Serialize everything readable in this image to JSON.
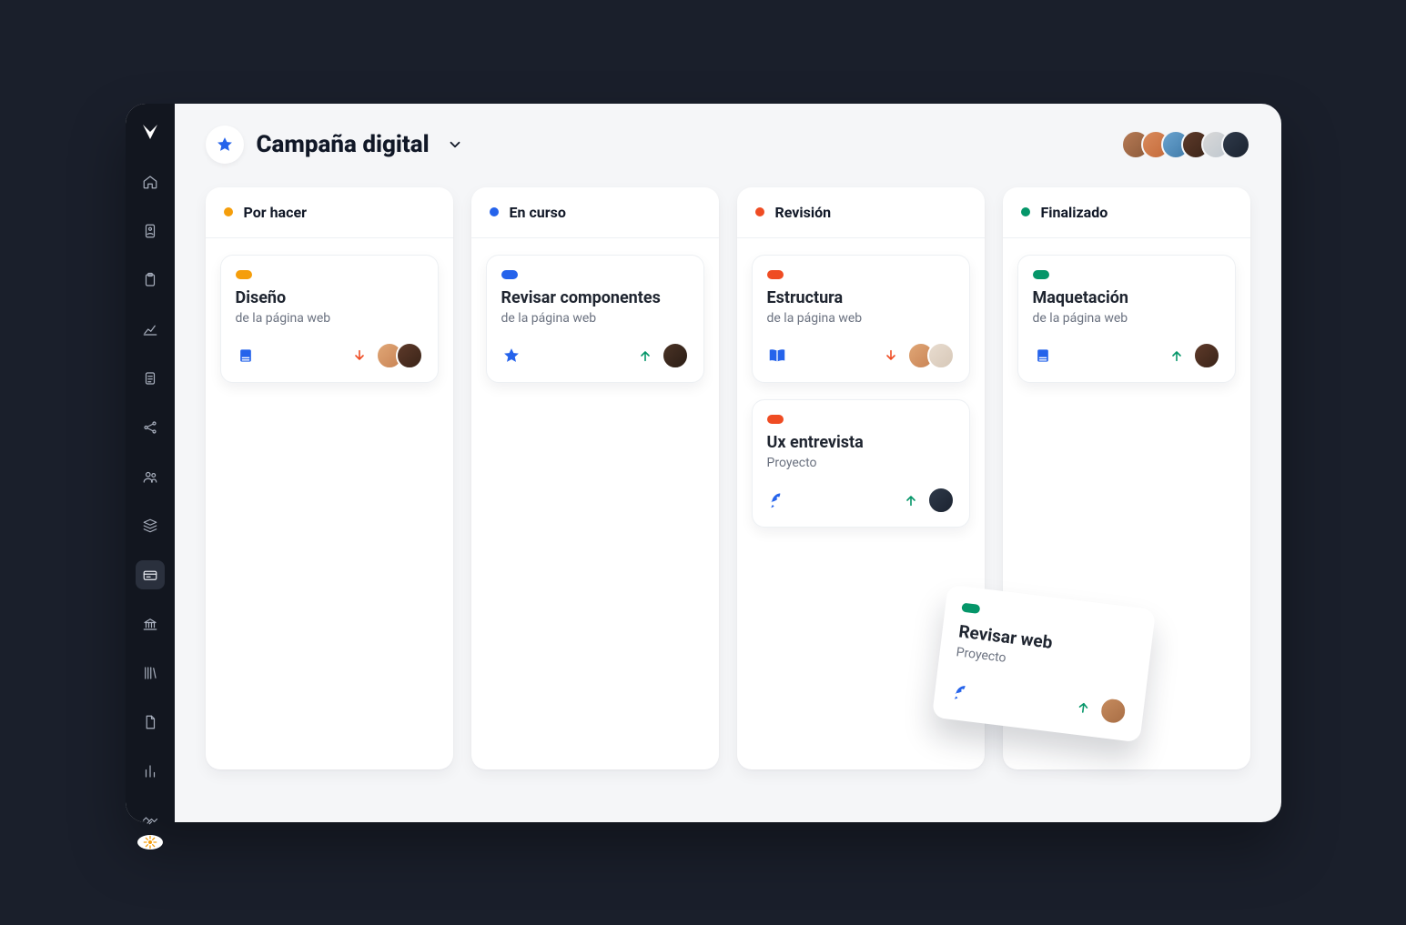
{
  "page": {
    "title": "Campaña digital"
  },
  "colors": {
    "orange": "#f59e0b",
    "blue": "#2563eb",
    "red": "#ef4c23",
    "green": "#059669"
  },
  "sidebar": {
    "items": [
      {
        "icon": "home"
      },
      {
        "icon": "id-badge"
      },
      {
        "icon": "clipboard"
      },
      {
        "icon": "chart"
      },
      {
        "icon": "note"
      },
      {
        "icon": "share"
      },
      {
        "icon": "team"
      },
      {
        "icon": "stack"
      },
      {
        "icon": "card",
        "active": true
      },
      {
        "icon": "bank"
      },
      {
        "icon": "books"
      },
      {
        "icon": "file"
      },
      {
        "icon": "bars"
      },
      {
        "icon": "handshake"
      }
    ]
  },
  "header_members": [
    {
      "avatar": "av1"
    },
    {
      "avatar": "av2"
    },
    {
      "avatar": "av3"
    },
    {
      "avatar": "av4"
    },
    {
      "avatar": "av5"
    },
    {
      "avatar": "av6"
    }
  ],
  "board": {
    "columns": [
      {
        "key": "todo",
        "title": "Por hacer",
        "dot_color": "orange",
        "cards": [
          {
            "tag_color": "orange",
            "title": "Diseño",
            "subtitle": "de la página web",
            "category_icon": "book",
            "priority": "low",
            "assignees": [
              "av7",
              "av4"
            ]
          }
        ]
      },
      {
        "key": "inprogress",
        "title": "En curso",
        "dot_color": "blue",
        "cards": [
          {
            "tag_color": "blue",
            "title": "Revisar componentes",
            "subtitle": "de la página web",
            "category_icon": "star",
            "priority": "high",
            "assignees": [
              "av8"
            ]
          }
        ]
      },
      {
        "key": "review",
        "title": "Revisión",
        "dot_color": "red",
        "cards": [
          {
            "tag_color": "red",
            "title": "Estructura",
            "subtitle": "de la página web",
            "category_icon": "book-open",
            "priority": "low",
            "assignees": [
              "av7",
              "av9"
            ]
          },
          {
            "tag_color": "red",
            "title": "Ux entrevista",
            "subtitle": "Proyecto",
            "category_icon": "rocket",
            "priority": "high",
            "assignees": [
              "av6"
            ]
          }
        ]
      },
      {
        "key": "done",
        "title": "Finalizado",
        "dot_color": "green",
        "cards": [
          {
            "tag_color": "green",
            "title": "Maquetación",
            "subtitle": "de la página web",
            "category_icon": "book",
            "priority": "high",
            "assignees": [
              "av4"
            ]
          }
        ]
      }
    ]
  },
  "floating_card": {
    "tag_color": "green",
    "title": "Revisar web",
    "subtitle": "Proyecto",
    "category_icon": "rocket",
    "priority": "high",
    "assignees": [
      "av10"
    ]
  }
}
